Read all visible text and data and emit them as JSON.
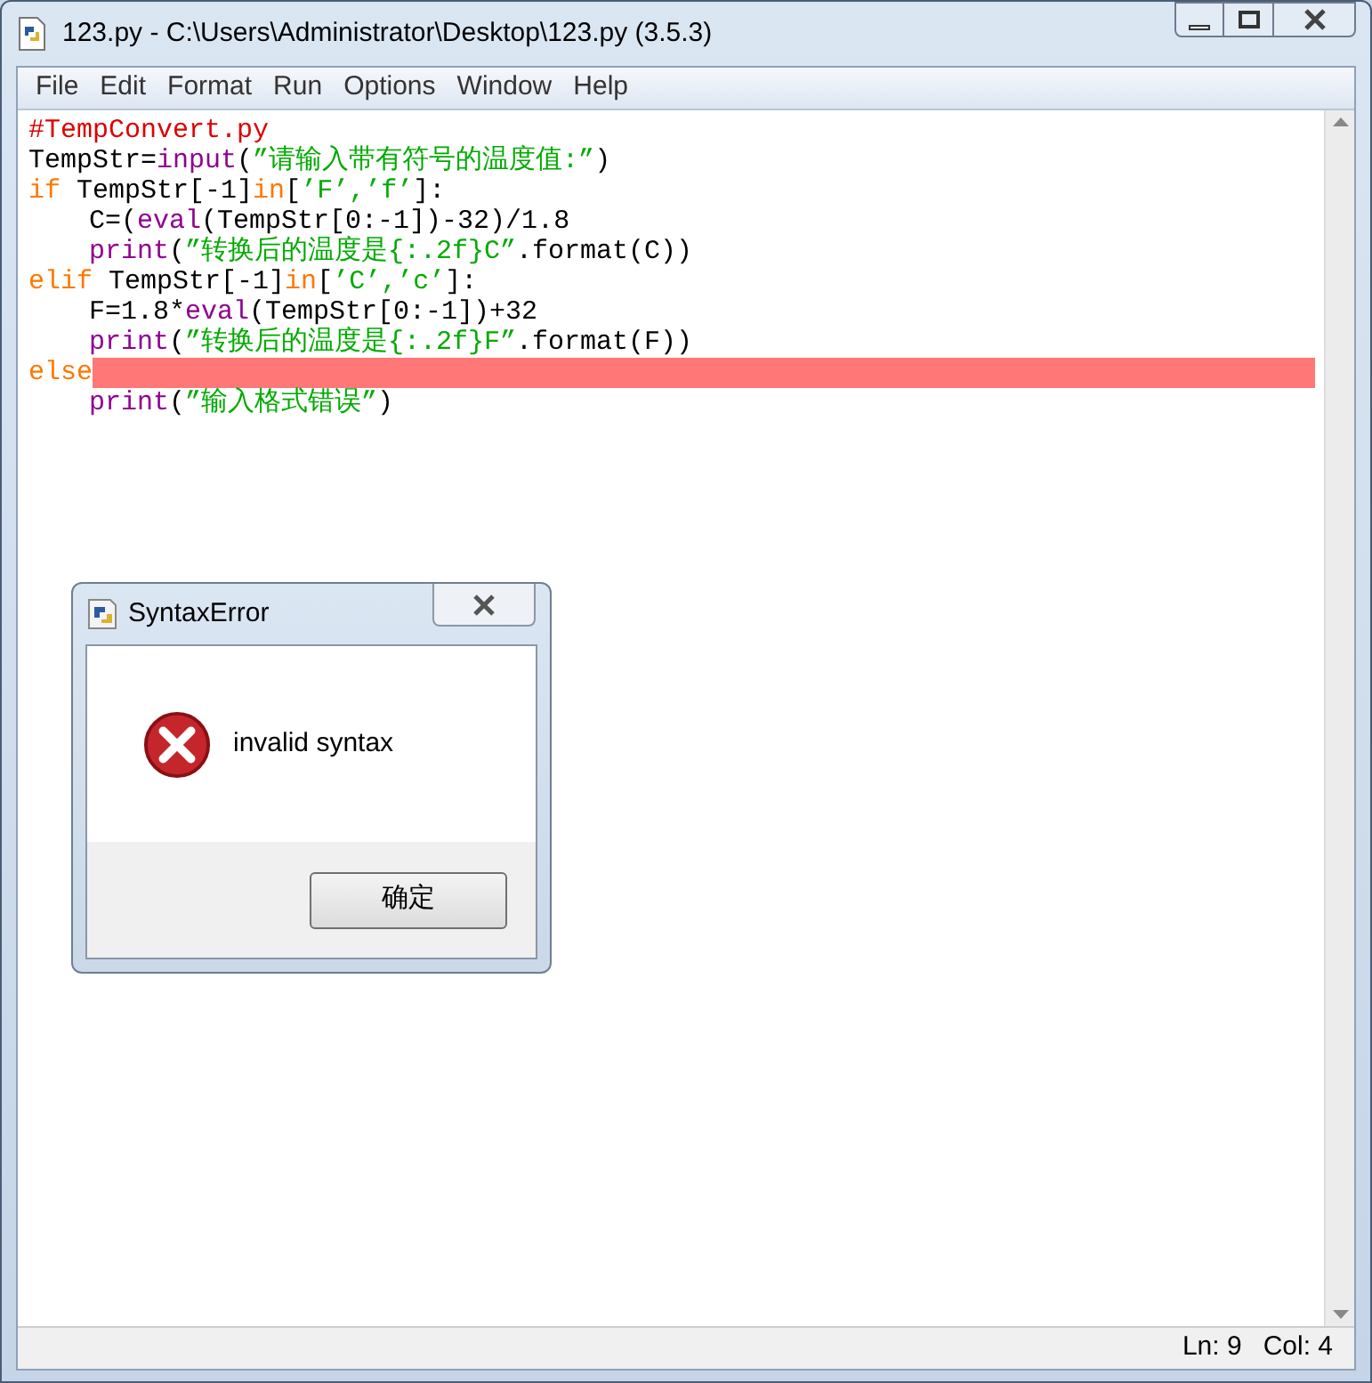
{
  "window": {
    "title": "123.py - C:\\Users\\Administrator\\Desktop\\123.py (3.5.3)"
  },
  "menu": [
    "File",
    "Edit",
    "Format",
    "Run",
    "Options",
    "Window",
    "Help"
  ],
  "code": [
    {
      "tokens": [
        {
          "kind": "comment",
          "text": "#TempConvert.py"
        }
      ]
    },
    {
      "tokens": [
        {
          "kind": "plain",
          "text": "TempStr="
        },
        {
          "kind": "builtin",
          "text": "input"
        },
        {
          "kind": "plain",
          "text": "("
        },
        {
          "kind": "string",
          "text": "”请输入带有符号的温度值:”"
        },
        {
          "kind": "plain",
          "text": ")"
        }
      ]
    },
    {
      "tokens": [
        {
          "kind": "keyword",
          "text": "if"
        },
        {
          "kind": "plain",
          "text": " TempStr[-1]"
        },
        {
          "kind": "keyword",
          "text": "in"
        },
        {
          "kind": "plain",
          "text": "["
        },
        {
          "kind": "string",
          "text": "’F’,’f’"
        },
        {
          "kind": "plain",
          "text": "]:"
        }
      ],
      "children": [
        {
          "tokens": [
            {
              "kind": "plain",
              "text": "C=("
            },
            {
              "kind": "builtin",
              "text": "eval"
            },
            {
              "kind": "plain",
              "text": "(TempStr[0:-1])-32)/1.8"
            }
          ]
        },
        {
          "tokens": [
            {
              "kind": "builtin",
              "text": "print"
            },
            {
              "kind": "plain",
              "text": "("
            },
            {
              "kind": "string",
              "text": "”转换后的温度是{:.2f}C”"
            },
            {
              "kind": "plain",
              "text": ".format(C))"
            }
          ]
        }
      ]
    },
    {
      "tokens": [
        {
          "kind": "keyword",
          "text": "elif"
        },
        {
          "kind": "plain",
          "text": " TempStr[-1]"
        },
        {
          "kind": "keyword",
          "text": "in"
        },
        {
          "kind": "plain",
          "text": "["
        },
        {
          "kind": "string",
          "text": "’C’,’c’"
        },
        {
          "kind": "plain",
          "text": "]:"
        }
      ],
      "children": [
        {
          "tokens": [
            {
              "kind": "plain",
              "text": "F=1.8*"
            },
            {
              "kind": "builtin",
              "text": "eval"
            },
            {
              "kind": "plain",
              "text": "(TempStr[0:-1])+32"
            }
          ]
        },
        {
          "tokens": [
            {
              "kind": "builtin",
              "text": "print"
            },
            {
              "kind": "plain",
              "text": "("
            },
            {
              "kind": "string",
              "text": "”转换后的温度是{:.2f}F”"
            },
            {
              "kind": "plain",
              "text": ".format(F))"
            }
          ]
        }
      ]
    },
    {
      "tokens": [
        {
          "kind": "keyword",
          "text": "else"
        }
      ],
      "error_highlight": true,
      "children": [
        {
          "tokens": [
            {
              "kind": "builtin",
              "text": "print"
            },
            {
              "kind": "plain",
              "text": "("
            },
            {
              "kind": "string",
              "text": "”输入格式错误”"
            },
            {
              "kind": "plain",
              "text": ")"
            }
          ]
        }
      ]
    }
  ],
  "dialog": {
    "title": "SyntaxError",
    "message": "invalid syntax",
    "button": "确定"
  },
  "status_bar": {
    "line": "Ln: 9",
    "column": "Col: 4"
  }
}
